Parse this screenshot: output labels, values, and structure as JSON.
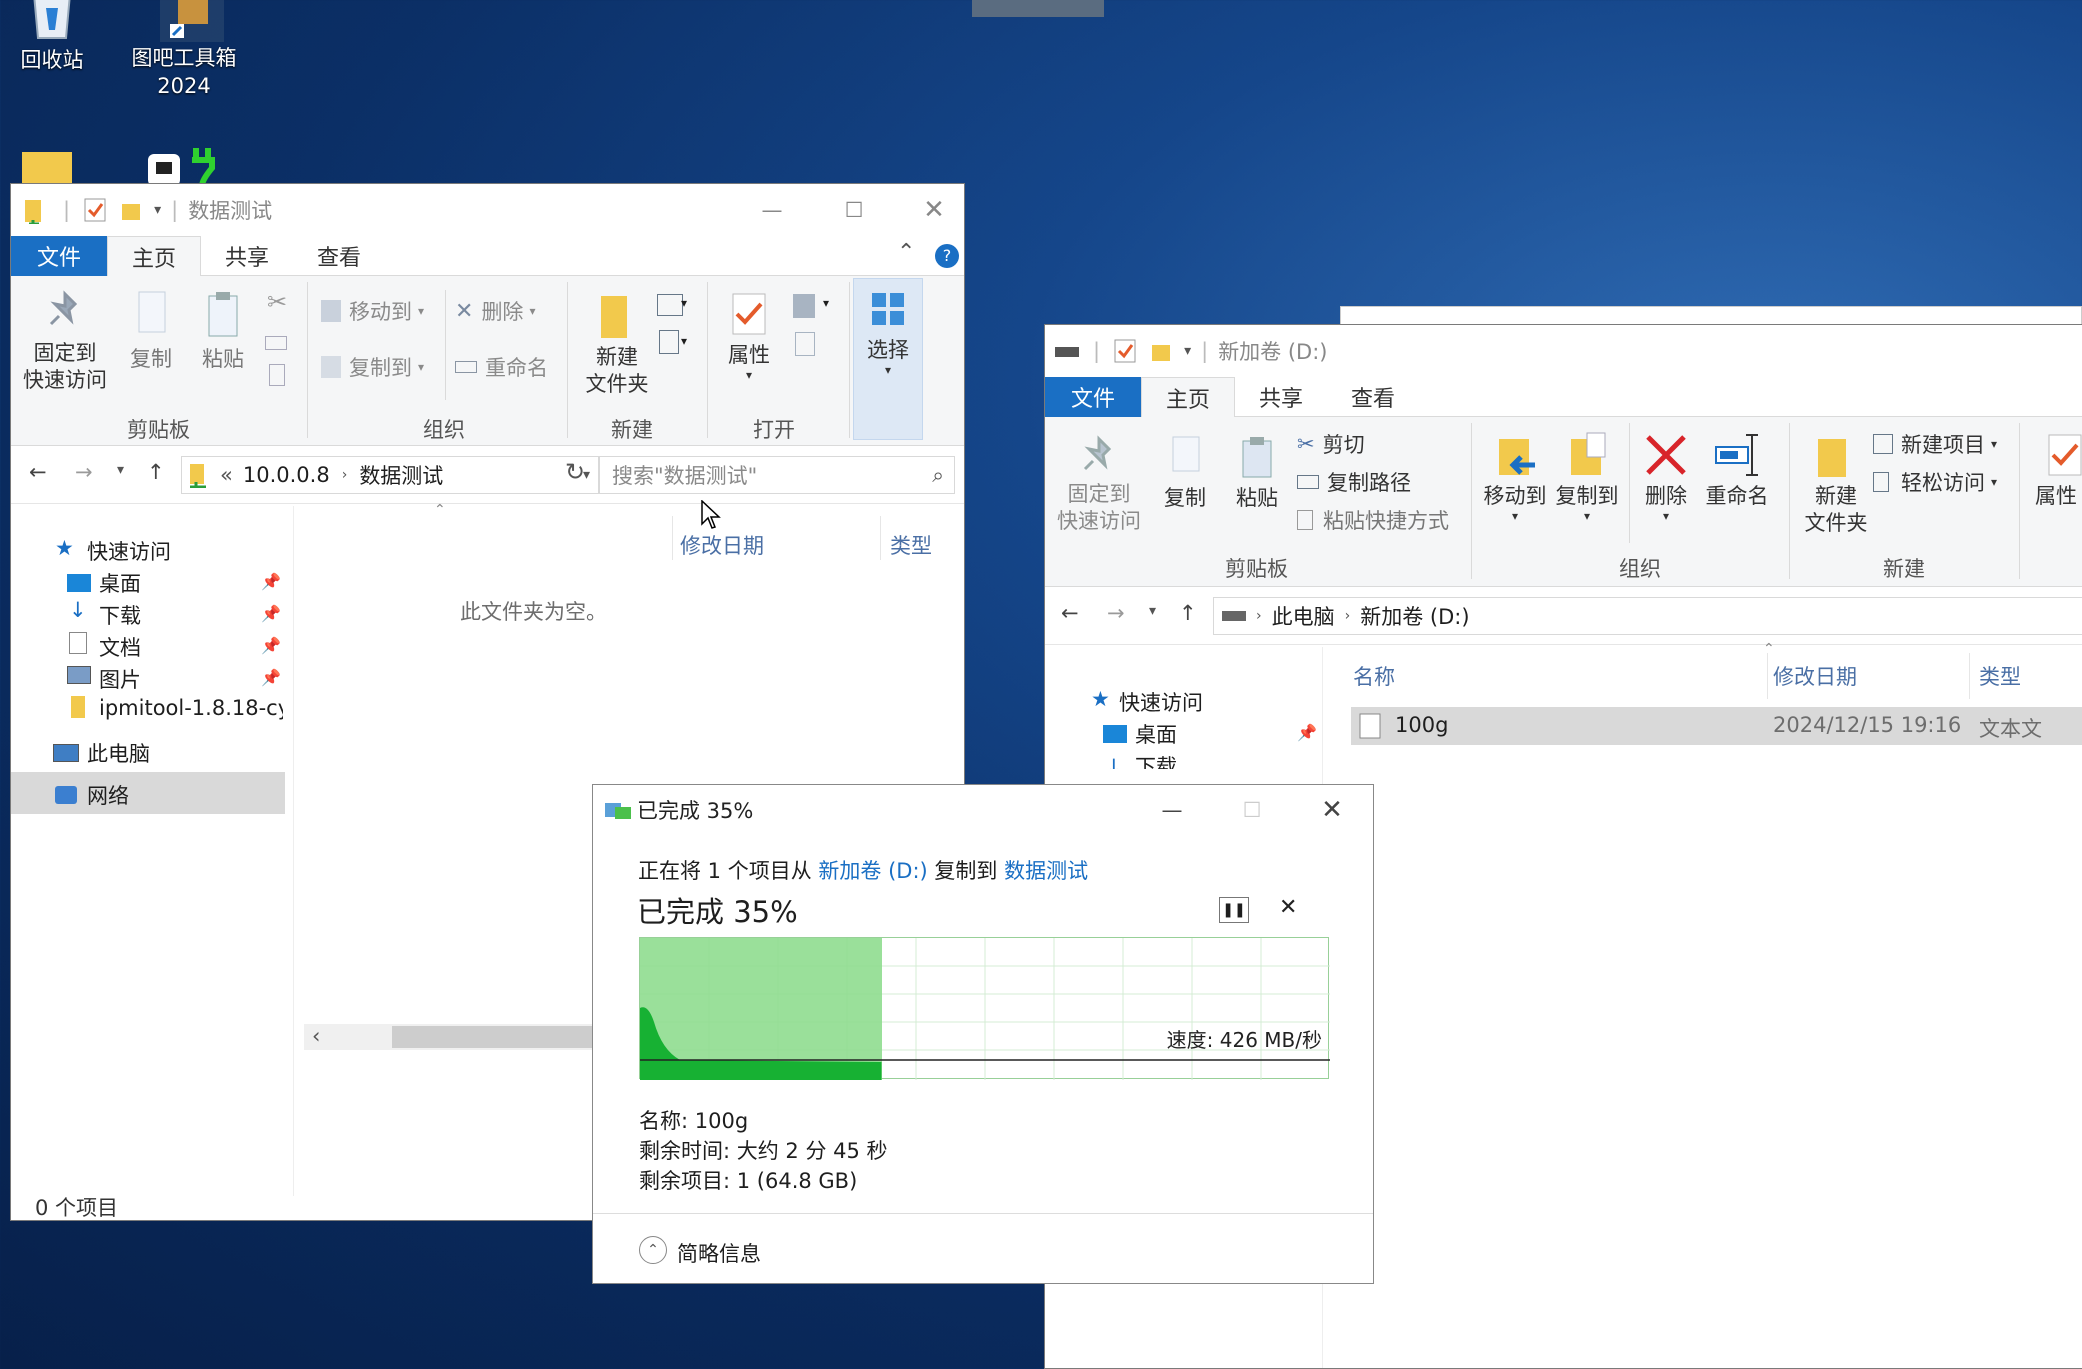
{
  "desktop": {
    "recycle_bin": "回收站",
    "tool_label_1": "图吧工具箱",
    "tool_label_2": "2024"
  },
  "win_left": {
    "title": "数据测试",
    "tabs": [
      "文件",
      "主页",
      "共享",
      "查看"
    ],
    "ribbon": {
      "pin_1": "固定到",
      "pin_2": "快速访问",
      "copy": "复制",
      "paste": "粘贴",
      "move_to": "移动到",
      "copy_to": "复制到",
      "delete": "删除",
      "rename": "重命名",
      "new_folder_1": "新建",
      "new_folder_2": "文件夹",
      "properties": "属性",
      "select": "选择",
      "groups": [
        "剪贴板",
        "组织",
        "新建",
        "打开"
      ]
    },
    "address": {
      "prefix": "«",
      "crumbs": [
        "10.0.0.8",
        "数据测试"
      ]
    },
    "search_placeholder": "搜索\"数据测试\"",
    "nav": {
      "quick_access": "快速访问",
      "items": [
        "桌面",
        "下载",
        "文档",
        "图片",
        "ipmitool-1.8.18-cy"
      ],
      "this_pc": "此电脑",
      "network": "网络"
    },
    "columns": {
      "date": "修改日期",
      "type": "类型"
    },
    "empty_msg": "此文件夹为空。",
    "status": "0 个项目"
  },
  "win_right": {
    "title": "新加卷 (D:)",
    "tabs": [
      "文件",
      "主页",
      "共享",
      "查看"
    ],
    "ribbon": {
      "pin_1": "固定到",
      "pin_2": "快速访问",
      "copy": "复制",
      "paste": "粘贴",
      "cut": "剪切",
      "copy_path": "复制路径",
      "paste_shortcut": "粘贴快捷方式",
      "move_to": "移动到",
      "copy_to": "复制到",
      "delete": "删除",
      "rename": "重命名",
      "new_folder_1": "新建",
      "new_folder_2": "文件夹",
      "new_item": "新建项目",
      "easy_access": "轻松访问",
      "properties": "属性",
      "groups": [
        "剪贴板",
        "组织",
        "新建"
      ]
    },
    "address": {
      "crumbs": [
        "此电脑",
        "新加卷 (D:)"
      ]
    },
    "nav": {
      "quick_access": "快速访问",
      "items": [
        "桌面",
        "下载"
      ]
    },
    "columns": {
      "name": "名称",
      "date": "修改日期",
      "type": "类型"
    },
    "files": [
      {
        "name": "100g",
        "date": "2024/12/15 19:16",
        "type": "文本文"
      }
    ]
  },
  "copy_dialog": {
    "title": "已完成 35%",
    "line_1": "正在将 1 个项目从",
    "source": "新加卷 (D:)",
    "line_mid": "复制到",
    "dest": "数据测试",
    "heading": "已完成 35%",
    "progress": 0.35,
    "speed": "速度: 426 MB/秒",
    "name_line": "名称: 100g",
    "time_line": "剩余时间: 大约 2 分 45 秒",
    "items_line": "剩余项目: 1 (64.8 GB)",
    "less_info": "简略信息",
    "colors": {
      "fill": "#8fdd8f",
      "graph": "#17b133"
    }
  }
}
